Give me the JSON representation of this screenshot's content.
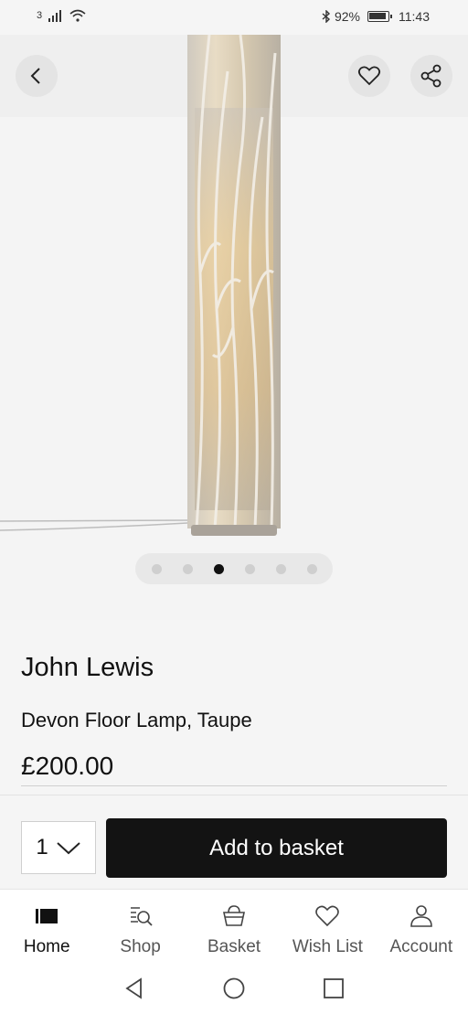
{
  "status_bar": {
    "sim": "3",
    "battery_pct": "92%",
    "time": "11:43",
    "icons": [
      "signal-icon",
      "wifi-icon",
      "bluetooth-icon",
      "battery-icon"
    ]
  },
  "gallery": {
    "image_count": 6,
    "active_index": 2
  },
  "product": {
    "brand": "John Lewis",
    "name": "Devon Floor Lamp, Taupe",
    "price": "£200.00"
  },
  "purchase": {
    "quantity": "1",
    "add_label": "Add to basket"
  },
  "tabs": [
    {
      "label": "Home",
      "icon": "home-icon",
      "active": true
    },
    {
      "label": "Shop",
      "icon": "shop-search-icon",
      "active": false
    },
    {
      "label": "Basket",
      "icon": "basket-icon",
      "active": false
    },
    {
      "label": "Wish List",
      "icon": "heart-icon",
      "active": false
    },
    {
      "label": "Account",
      "icon": "account-icon",
      "active": false
    }
  ],
  "colors": {
    "button_bg": "#131313",
    "page_bg": "#f5f5f5"
  }
}
